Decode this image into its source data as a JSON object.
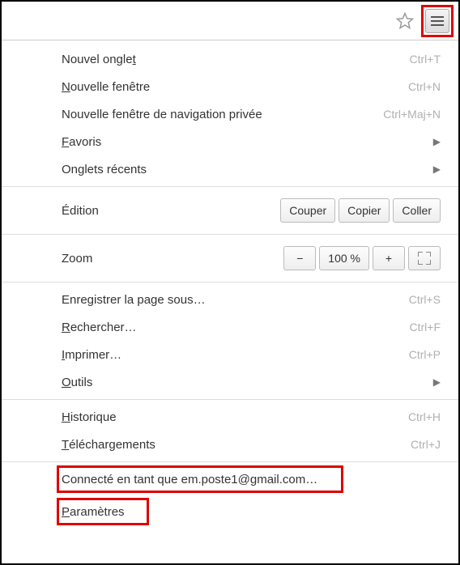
{
  "topbar": {
    "star": "star-icon",
    "hamburger": "hamburger-icon"
  },
  "menu": {
    "newTab": {
      "label": "Nouvel onglet",
      "u": "t",
      "shortcut": "Ctrl+T"
    },
    "newWindow": {
      "label_pre": "",
      "label_u": "N",
      "label_post": "ouvelle fenêtre",
      "shortcut": "Ctrl+N"
    },
    "newPrivate": {
      "label": "Nouvelle fenêtre de navigation privée",
      "shortcut": "Ctrl+Maj+N"
    },
    "favorites": {
      "label_u": "F",
      "label_post": "avoris"
    },
    "recentTabs": {
      "label": "Onglets récents"
    },
    "edition": {
      "label": "Édition",
      "cut": "Couper",
      "copy": "Copier",
      "paste": "Coller"
    },
    "zoom": {
      "label": "Zoom",
      "minus": "−",
      "value": "100 %",
      "plus": "+"
    },
    "savePage": {
      "label": "Enregistrer la page sous…",
      "shortcut": "Ctrl+S"
    },
    "find": {
      "label_u": "R",
      "label_post": "echercher…",
      "shortcut": "Ctrl+F"
    },
    "print": {
      "label_u": "I",
      "label_post": "mprimer…",
      "shortcut": "Ctrl+P"
    },
    "tools": {
      "label_u": "O",
      "label_post": "utils"
    },
    "history": {
      "label_u": "H",
      "label_post": "istorique",
      "shortcut": "Ctrl+H"
    },
    "downloads": {
      "label_u": "T",
      "label_post": "éléchargements",
      "shortcut": "Ctrl+J"
    },
    "connected": {
      "label": "Connecté en tant que em.poste1@gmail.com…"
    },
    "settings": {
      "label_u": "P",
      "label_post": "aramètres"
    }
  }
}
